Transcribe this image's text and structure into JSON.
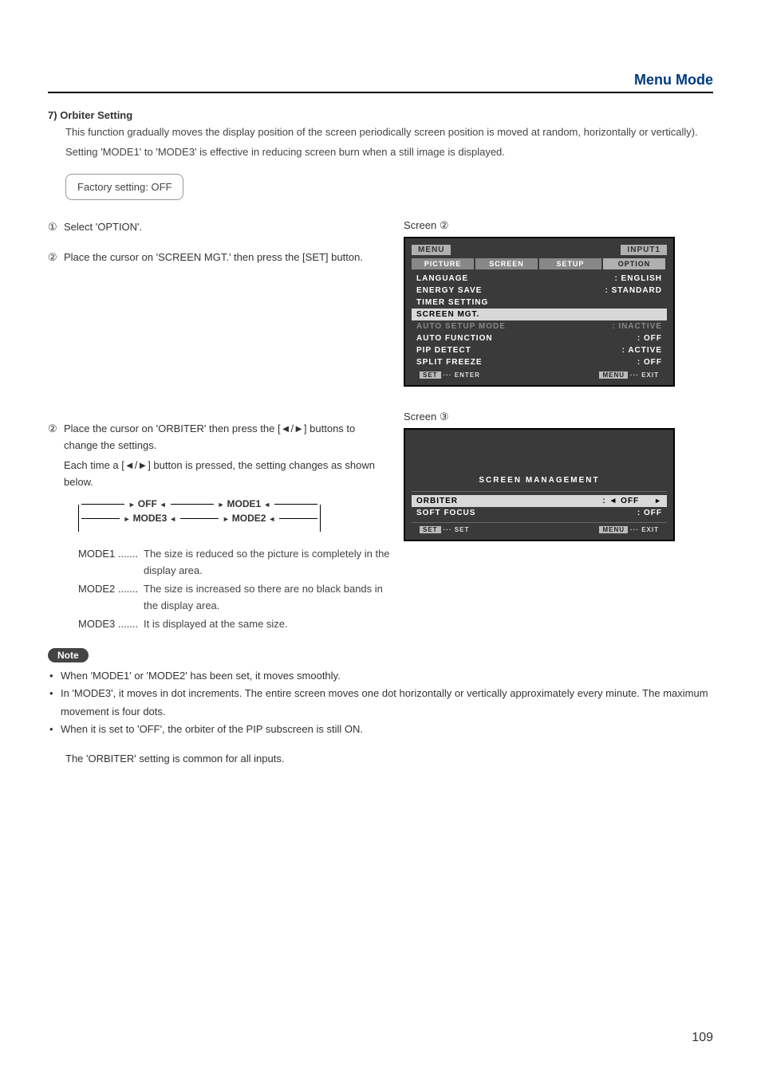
{
  "header": {
    "title": "Menu Mode"
  },
  "section": {
    "number": "7)",
    "title": "Orbiter Setting",
    "intro1": "This function gradually moves the display position of the screen periodically screen position is moved at random, horizontally or vertically).",
    "intro2": "Setting 'MODE1' to 'MODE3' is effective in reducing screen burn when a still image is displayed.",
    "factory": "Factory setting: OFF"
  },
  "steps": {
    "s1_num": "①",
    "s1_text": "Select 'OPTION'.",
    "s2_num": "②",
    "s2_text": "Place the cursor on 'SCREEN MGT.' then press the [SET] button.",
    "s3_num": "②",
    "s3_text": "Place the cursor on 'ORBITER' then press the [◄/►] buttons to change the settings.",
    "s3_sub": "Each time a [◄/►] button is pressed, the setting changes as shown below."
  },
  "cycle": {
    "off": "OFF",
    "mode1": "MODE1",
    "mode2": "MODE2",
    "mode3": "MODE3"
  },
  "modes": {
    "m1_label": "MODE1 .......",
    "m1_desc": "The size is reduced so the picture is completely in the display area.",
    "m2_label": "MODE2 .......",
    "m2_desc": "The size is increased so there are no black bands in the display area.",
    "m3_label": "MODE3 .......",
    "m3_desc": "It is displayed at the same size."
  },
  "note": {
    "label": "Note",
    "b1": "When 'MODE1' or 'MODE2' has been set, it moves smoothly.",
    "b2": "In 'MODE3', it moves in dot increments. The entire screen moves one dot horizontally or vertically approximately every minute. The maximum movement is four dots.",
    "b3": "When it is set to 'OFF', the orbiter of the PIP subscreen is still ON."
  },
  "closing": "The 'ORBITER' setting is common for all inputs.",
  "screen2": {
    "label_prefix": "Screen ",
    "label_num": "②",
    "menu": "MENU",
    "input": "INPUT1",
    "tabs": [
      "PICTURE",
      "SCREEN",
      "SETUP",
      "OPTION"
    ],
    "rows": [
      {
        "l": "LANGUAGE",
        "r": ": ENGLISH"
      },
      {
        "l": "ENERGY SAVE",
        "r": ": STANDARD"
      },
      {
        "l": "TIMER SETTING",
        "r": ""
      },
      {
        "l": "SCREEN MGT.",
        "r": "",
        "hl": true
      },
      {
        "l": "AUTO SETUP MODE",
        "r": ": INACTIVE",
        "dim": true
      },
      {
        "l": "AUTO FUNCTION",
        "r": ": OFF"
      },
      {
        "l": "PIP DETECT",
        "r": ": ACTIVE"
      },
      {
        "l": "SPLIT FREEZE",
        "r": ": OFF"
      }
    ],
    "footer_l_btn": "SET",
    "footer_l_txt": "··· ENTER",
    "footer_r_btn": "MENU",
    "footer_r_txt": "··· EXIT"
  },
  "screen3": {
    "label_prefix": "Screen ",
    "label_num": "③",
    "title": "SCREEN MANAGEMENT",
    "row1_l": "ORBITER",
    "row1_r": ": ◄ OFF",
    "row2_l": "SOFT FOCUS",
    "row2_r": ":   OFF",
    "footer_l_btn": "SET",
    "footer_l_txt": "··· SET",
    "footer_r_btn": "MENU",
    "footer_r_txt": "··· EXIT"
  },
  "pagenum": "109"
}
